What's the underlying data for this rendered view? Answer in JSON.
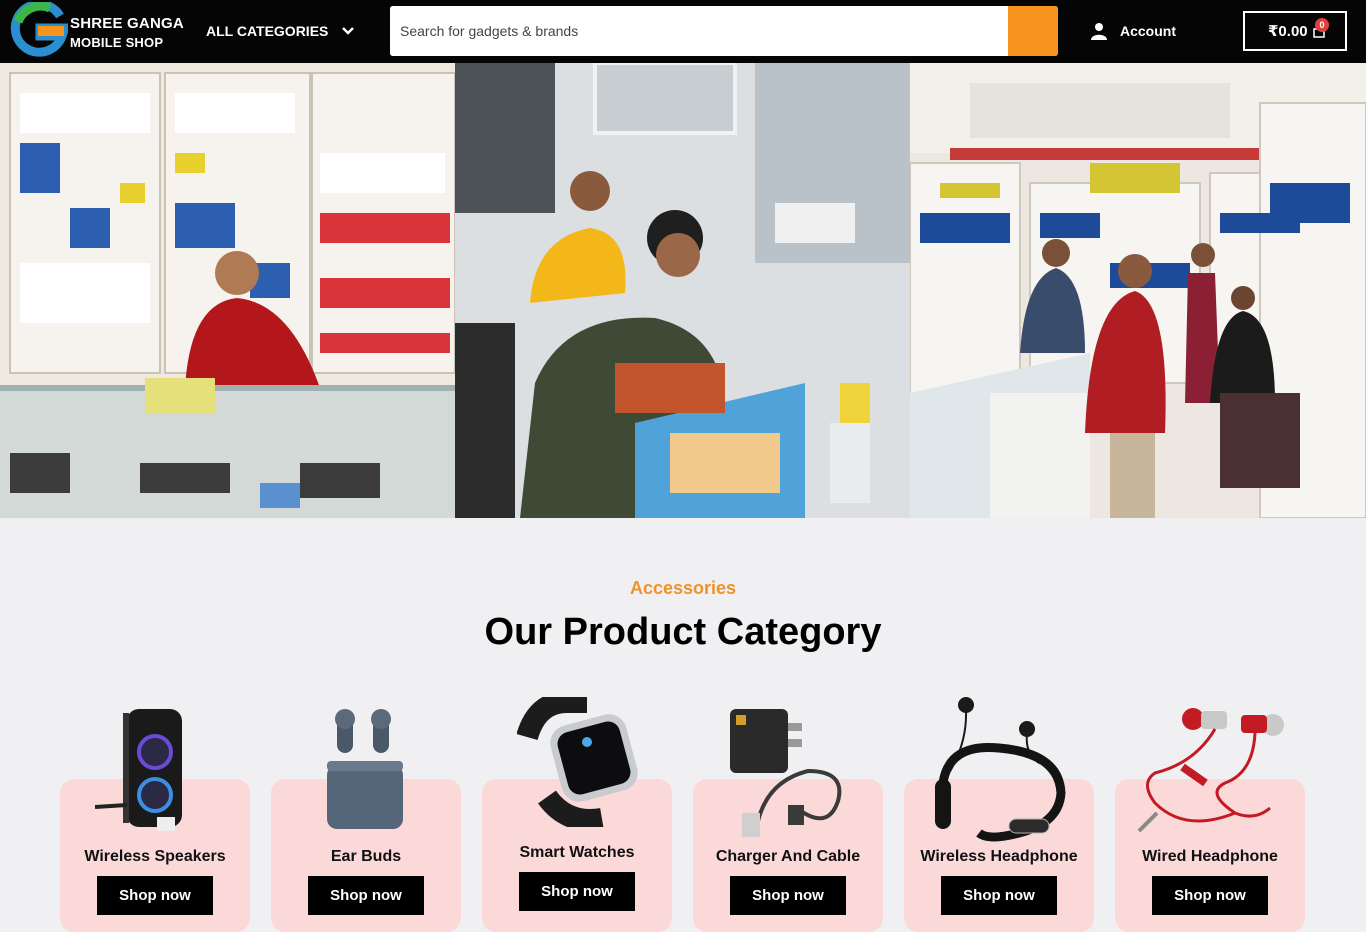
{
  "header": {
    "logo_line1": "SHREE GANGA",
    "logo_line2": "MOBILE SHOP",
    "all_categories": "ALL CATEGORIES",
    "search_placeholder": "Search for gadgets & brands",
    "account_label": "Account",
    "cart_total": "₹0.00",
    "cart_count": "0"
  },
  "section": {
    "eyebrow": "Accessories",
    "title": "Our Product Category"
  },
  "categories": [
    {
      "label": "Wireless Speakers",
      "button": "Shop now"
    },
    {
      "label": "Ear Buds",
      "button": "Shop now"
    },
    {
      "label": "Smart Watches",
      "button": "Shop now"
    },
    {
      "label": "Charger And Cable",
      "button": "Shop now"
    },
    {
      "label": "Wireless Headphone",
      "button": "Shop now"
    },
    {
      "label": "Wired Headphone",
      "button": "Shop now"
    }
  ],
  "colors": {
    "header_bg": "#050505",
    "accent_orange": "#f7941d",
    "eyebrow": "#f0922a",
    "card_bg": "#fcd9d9",
    "badge": "#e0403c"
  },
  "icons": [
    "logo-g-icon",
    "chevron-down-icon",
    "user-icon",
    "shopping-bag-icon"
  ]
}
